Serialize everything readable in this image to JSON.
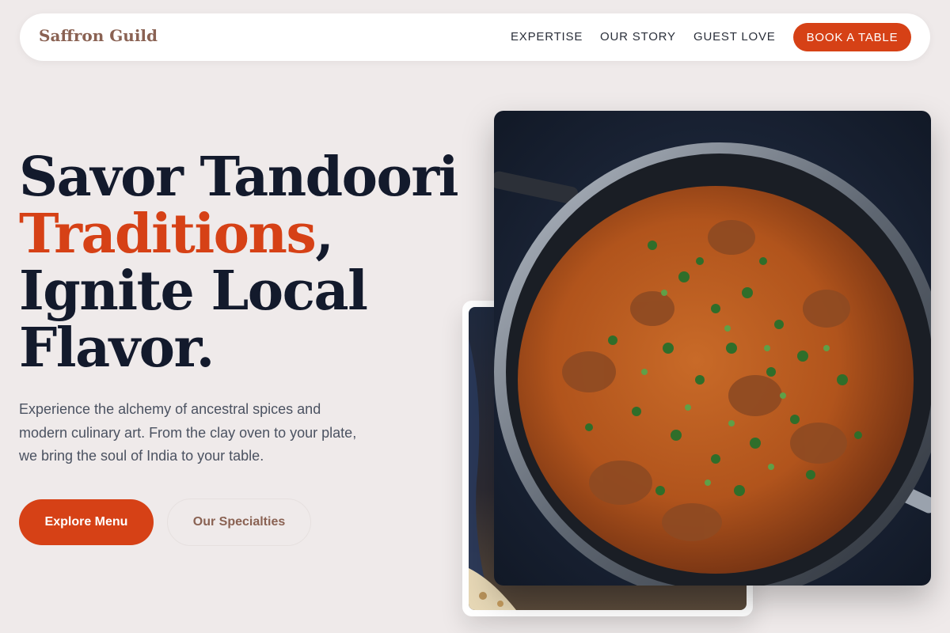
{
  "brand": {
    "name": "Saffron Guild"
  },
  "nav": {
    "links": [
      {
        "label": "EXPERTISE"
      },
      {
        "label": "OUR STORY"
      },
      {
        "label": "GUEST LOVE"
      }
    ],
    "cta_label": "BOOK A TABLE"
  },
  "hero": {
    "headline": {
      "line1": "Savor Tandoori",
      "line2_accent": "Traditions",
      "line2_rest": ",",
      "line3": "Ignite Local",
      "line4": "Flavor."
    },
    "description": "Experience the alchemy of ancestral spices and modern culinary art. From the clay oven to your plate, we bring the soul of India to your table.",
    "primary_button": "Explore Menu",
    "secondary_button": "Our Specialties"
  },
  "images": {
    "main_photo": "curry-pan-photo",
    "secondary_photo": "naan-bread-photo"
  },
  "colors": {
    "accent": "#d64116",
    "brand": "#8a6253",
    "heading": "#131a2c",
    "background": "#efeaea"
  }
}
